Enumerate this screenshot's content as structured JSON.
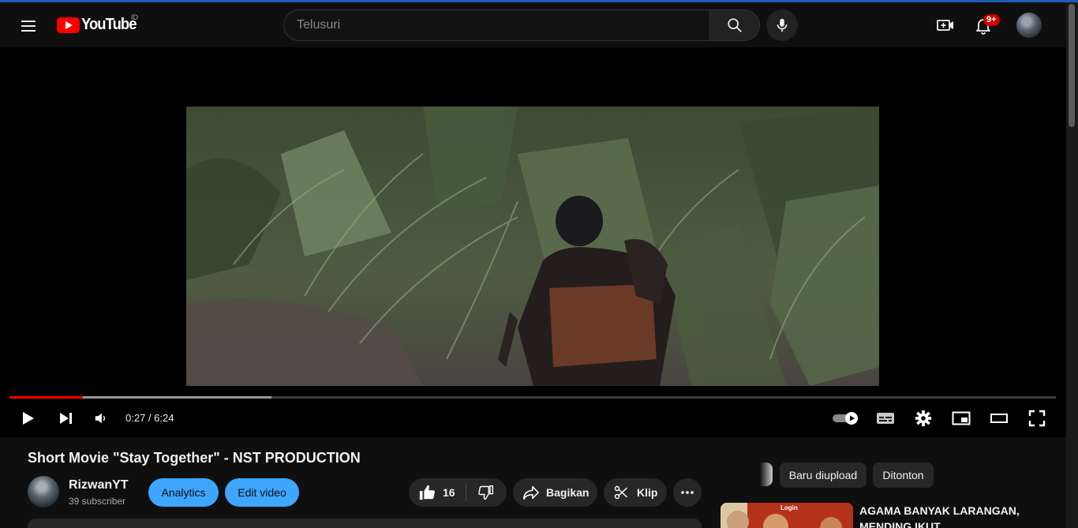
{
  "masthead": {
    "logo_text": "YouTube",
    "country_code": "ID",
    "search_placeholder": "Telusuri",
    "notification_count": "9+",
    "icons": [
      "menu-icon",
      "search-icon",
      "microphone-icon",
      "create-video-icon",
      "bell-icon",
      "avatar"
    ]
  },
  "player": {
    "current_time": "0:27",
    "duration": "6:24",
    "time_display": "0:27 / 6:24",
    "progress_fraction": 0.07,
    "buffered_fraction": 0.25,
    "controls": [
      "play-icon",
      "next-icon",
      "volume-icon",
      "autoplay-toggle",
      "subtitles-icon",
      "settings-icon",
      "miniplayer-icon",
      "theater-icon",
      "fullscreen-icon"
    ]
  },
  "video": {
    "title": "Short Movie \"Stay Together\" - NST PRODUCTION",
    "channel_name": "RizwanYT",
    "subscribers": "39 subscriber",
    "analytics_label": "Analytics",
    "edit_label": "Edit video",
    "like_count": "16",
    "share_label": "Bagikan",
    "clip_label": "Klip"
  },
  "sidebar": {
    "chips": [
      "Baru diupload",
      "Ditonton"
    ],
    "recommendations": [
      {
        "title": "AGAMA BANYAK LARANGAN, MENDING IKUT",
        "thumb_text": "Login"
      }
    ]
  },
  "colors": {
    "background": "#0f0f0f",
    "accent_red": "#ff0000",
    "button_blue": "#3ea6ff",
    "chip_bg": "#272727"
  }
}
